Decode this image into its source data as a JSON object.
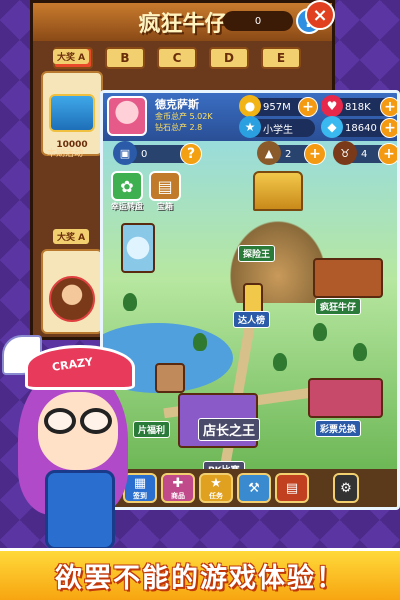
{
  "back_screen": {
    "title": "疯狂牛仔",
    "coin_count": "0",
    "help": "?",
    "close": "×",
    "tabs": [
      "A",
      "B",
      "C",
      "D",
      "E"
    ],
    "prize_badge_1": "大奖 A",
    "prize_value_1": "10000",
    "note": "本期活动",
    "prize_badge_2": "大奖 A"
  },
  "player": {
    "name": "德克萨斯",
    "stat_1_label": "金币总产",
    "stat_1_value": "5.02K",
    "stat_2_label": "钻石总产",
    "stat_2_value": "2.8",
    "title": "小学生"
  },
  "resources": {
    "gold": "957M",
    "hearts": "818K",
    "diamonds": "18640",
    "tickets": "0",
    "helmet": "2",
    "bull": "4"
  },
  "side_buttons": {
    "lottery": "幸运转盘",
    "chest": "宝箱"
  },
  "map_labels": {
    "treasure": "探险王",
    "ranking": "达人榜",
    "cowboy": "疯狂牛仔",
    "market": "彩票兑换",
    "pk": "PK比赛",
    "lucky": "片福利",
    "shop": "店长之王"
  },
  "bottom_bar": {
    "b1": "签到",
    "b2": "商品",
    "b3": "任务",
    "b4": "",
    "b5": ""
  },
  "character": {
    "cap_text": "CRAZY"
  },
  "caption": "欲罢不能的游戏体验！",
  "colors": {
    "caption_band": "#f7a510",
    "top_bar": "#2a4f96",
    "plus": "#f39a12"
  }
}
